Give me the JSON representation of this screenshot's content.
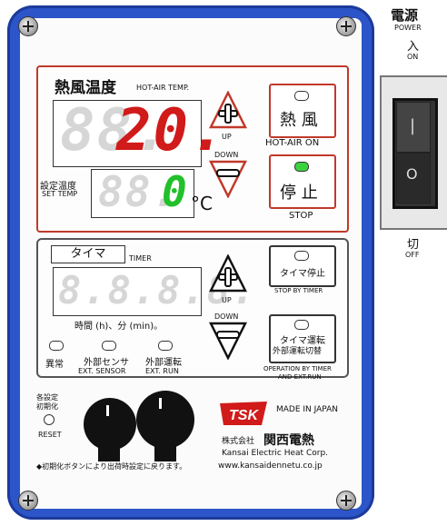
{
  "power": {
    "title_jp": "電源",
    "title_en": "POWER",
    "on_jp": "入",
    "on_en": "ON",
    "off_jp": "切",
    "off_en": "OFF",
    "rocker_on_mark": "|",
    "rocker_off_mark": "O"
  },
  "heat_section": {
    "title_jp": "熱風温度",
    "title_en": "HOT-AIR TEMP.",
    "current_ghost": "88.",
    "current_value": "20.",
    "set_label_jp": "設定温度",
    "set_label_en": "SET TEMP",
    "set_ghost": "88.",
    "set_value": "0",
    "unit": "°C",
    "up_label": "UP",
    "down_label": "DOWN",
    "heat_button_label": "熱 風",
    "heat_button_caption": "HOT-AIR ON",
    "stop_button_label": "停 止",
    "stop_button_caption": "STOP"
  },
  "timer_section": {
    "title_jp": "タイマ",
    "title_en": "TIMER",
    "display_ghost": "8.8.8.8.",
    "units_caption": "時間 (h)、分 (min)。",
    "up_label": "UP",
    "down_label": "DOWN",
    "timer_stop_label": "タイマ停止",
    "timer_stop_caption": "STOP BY TIMER",
    "timer_run_label_1": "タイマ運転",
    "timer_run_label_2": "外部運転切替",
    "timer_run_caption_1": "OPERATION BY TIMER",
    "timer_run_caption_2": "AND EXT.RUN"
  },
  "indicators": [
    {
      "label_jp": "異常",
      "label_en": ""
    },
    {
      "label_jp": "外部センサ",
      "label_en": "EXT. SENSOR"
    },
    {
      "label_jp": "外部運転",
      "label_en": "EXT. RUN"
    }
  ],
  "reset": {
    "label_jp_1": "各設定",
    "label_jp_2": "初期化",
    "label_en": "RESET"
  },
  "brand": {
    "logo": "TSK",
    "made_in": "MADE IN JAPAN",
    "company_prefix": "株式会社",
    "company_jp": "関西電熱",
    "company_en": "Kansai Electric Heat Corp.",
    "url": "www.kansaidennetu.co.jp"
  },
  "footnote": "◆初期化ボタンにより出荷時設定に戻ります。",
  "colors": {
    "frame_blue": "#2c55c9",
    "heat_red": "#c0392b",
    "digit_red": "#d11a1a",
    "digit_green": "#22c02a",
    "led_green": "#3bd23f"
  }
}
